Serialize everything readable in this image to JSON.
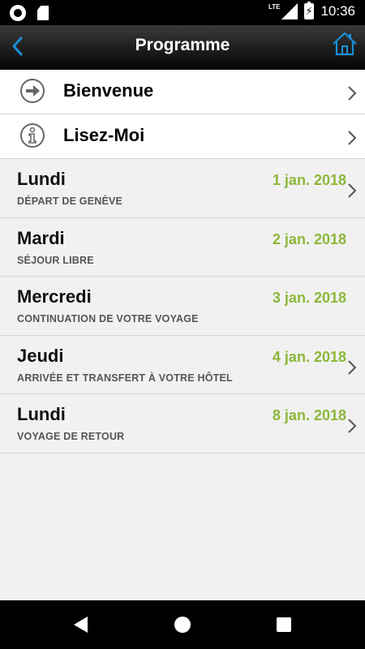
{
  "status_bar": {
    "network": "LTE",
    "time": "10:36"
  },
  "header": {
    "title": "Programme",
    "back_icon": "chevron-left-icon",
    "home_icon": "home-icon",
    "accent_color": "#1a8fd8"
  },
  "menu": [
    {
      "label": "Bienvenue",
      "icon": "arrow-circle-icon"
    },
    {
      "label": "Lisez-Moi",
      "icon": "info-icon"
    }
  ],
  "days": [
    {
      "name": "Lundi",
      "subtitle": "DÉPART DE GENÈVE",
      "date": "1 jan. 2018",
      "has_chevron": true
    },
    {
      "name": "Mardi",
      "subtitle": "SÉJOUR LIBRE",
      "date": "2 jan. 2018",
      "has_chevron": false
    },
    {
      "name": "Mercredi",
      "subtitle": "CONTINUATION DE VOTRE VOYAGE",
      "date": "3 jan. 2018",
      "has_chevron": false
    },
    {
      "name": "Jeudi",
      "subtitle": "ARRIVÉE ET TRANSFERT À VOTRE HÔTEL",
      "date": "4 jan. 2018",
      "has_chevron": true
    },
    {
      "name": "Lundi",
      "subtitle": "VOYAGE DE RETOUR",
      "date": "8 jan. 2018",
      "has_chevron": true
    }
  ],
  "colors": {
    "date_green": "#8cb83a",
    "background": "#f1f1f1"
  }
}
